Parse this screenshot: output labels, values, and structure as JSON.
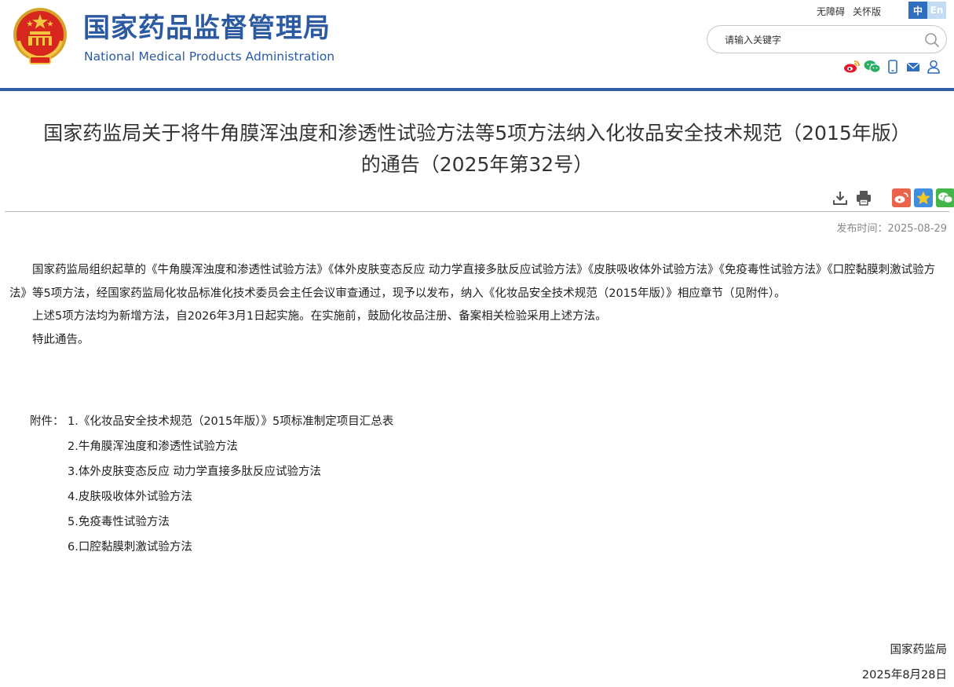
{
  "header": {
    "title": "国家药品监督管理局",
    "subtitle": "National Medical Products Administration",
    "accessibility_link": "无障碍",
    "elderly_link": "关怀版",
    "lang_zh": "中",
    "lang_en": "En",
    "search_placeholder": "请输入关键字",
    "social_icons": [
      "weibo-icon",
      "wechat-icon",
      "mobile-icon",
      "mail-icon",
      "user-icon"
    ],
    "colors": {
      "brand_blue": "#2c5aa0",
      "bar_blue": "#2f5ea7"
    }
  },
  "article": {
    "title_line1": "国家药监局关于将牛角膜浑浊度和渗透性试验方法等5项方法纳入化妆品安全技术规范（2015年版）",
    "title_line2": "的通告（2025年第32号）",
    "tools": [
      "download-icon",
      "print-icon"
    ],
    "share": [
      "weibo-share-icon",
      "qzone-share-icon",
      "wechat-share-icon"
    ],
    "publish_date": "发布时间：2025-08-29",
    "paragraphs": [
      "国家药监局组织起草的《牛角膜浑浊度和渗透性试验方法》《体外皮肤变态反应 动力学直接多肽反应试验方法》《皮肤吸收体外试验方法》《免疫毒性试验方法》《口腔黏膜刺激试验方法》等5项方法，经国家药监局化妆品标准化技术委员会主任会议审查通过，现予以发布，纳入《化妆品安全技术规范（2015年版）》相应章节（见附件）。",
      "上述5项方法均为新增方法，自2026年3月1日起实施。在实施前，鼓励化妆品注册、备案相关检验采用上述方法。",
      "特此通告。"
    ],
    "attachments_label": "附件：",
    "attachments": [
      "1.《化妆品安全技术规范（2015年版）》5项标准制定项目汇总表",
      "2.牛角膜浑浊度和渗透性试验方法",
      "3.体外皮肤变态反应 动力学直接多肽反应试验方法",
      "4.皮肤吸收体外试验方法",
      "5.免疫毒性试验方法",
      "6.口腔黏膜刺激试验方法"
    ],
    "signature": "国家药监局",
    "sign_date": "2025年8月28日"
  }
}
